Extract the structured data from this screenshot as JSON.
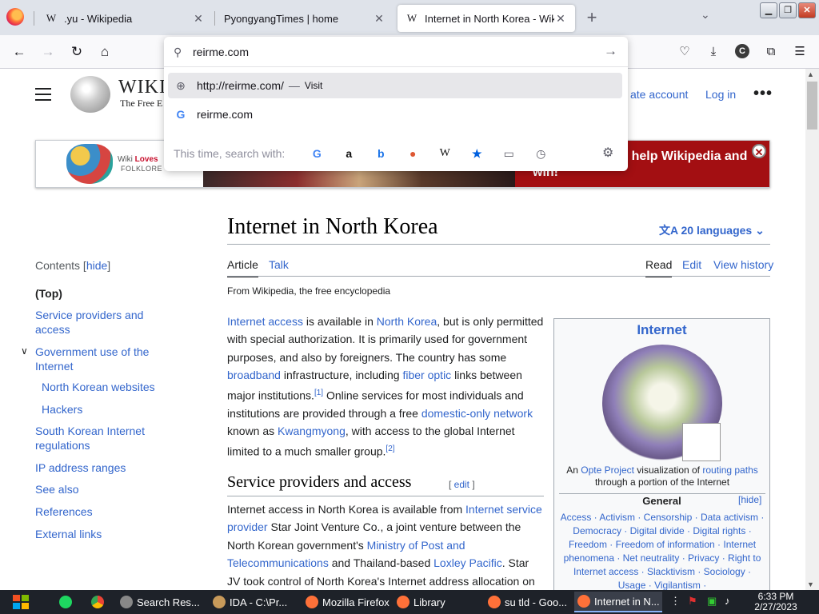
{
  "tabs": [
    {
      "title": ".yu - Wikipedia",
      "favicon": "W"
    },
    {
      "title": "PyongyangTimes | home",
      "favicon": ""
    },
    {
      "title": "Internet in North Korea - Wikipedia",
      "favicon": "W"
    }
  ],
  "url_bar": {
    "value": "reirme.com",
    "suggestions": [
      {
        "url": "http://reirme.com/",
        "action": "Visit"
      },
      {
        "text": "reirme.com"
      }
    ],
    "search_with_label": "This time, search with:",
    "engines": [
      "google-icon",
      "amazon-icon",
      "bing-icon",
      "duckduckgo-icon",
      "wikipedia-icon",
      "bookmarks-icon",
      "tabs-icon",
      "history-icon"
    ]
  },
  "wiki_header": {
    "wordmark": "WIKI",
    "tagline": "The Free E",
    "create_account": "ate account",
    "log_in": "Log in"
  },
  "banner": {
    "logo_line1a": "Wiki ",
    "logo_line1b": "Loves",
    "logo_line2": "FOLKLORE",
    "text": "ur local culture, help Wikipedia and win!"
  },
  "article": {
    "title": "Internet in North Korea",
    "languages": "20 languages",
    "tabs_left": [
      "Article",
      "Talk"
    ],
    "tabs_right": [
      "Read",
      "Edit",
      "View history"
    ],
    "tagline": "From Wikipedia, the free encyclopedia",
    "para1": {
      "a1": "Internet access",
      "t1": " is available in ",
      "a2": "North Korea",
      "t2": ", but is only permitted with special authorization. It is primarily used for government purposes, and also by foreigners. The country has some ",
      "a3": "broadband",
      "t3": " infrastructure, including ",
      "a4": "fiber optic",
      "t4": " links between major institutions.",
      "ref1": "[1]",
      "t5": " Online services for most individuals and institutions are provided through a free ",
      "a5": "domestic-only network",
      "t6": " known as ",
      "a6": "Kwangmyong",
      "t7": ", with access to the global Internet limited to a much smaller group.",
      "ref2": "[2]"
    },
    "section1": {
      "heading": "Service providers and access",
      "edit_open": "[ ",
      "edit": "edit",
      "edit_close": " ]",
      "t1": "Internet access in North Korea is available from ",
      "a1": "Internet service provider",
      "t2": " Star Joint Venture Co., a joint venture between the North Korean government's ",
      "a2": "Ministry of Post and Telecommunications",
      "t3": " and Thailand-based ",
      "a3": "Loxley Pacific",
      "t4": ". Star JV took control of North Korea's Internet address allocation on"
    }
  },
  "toc": {
    "heading": "Contents",
    "hide": "hide",
    "items": [
      "(Top)",
      "Service providers and access",
      "Government use of the Internet",
      "North Korean websites",
      "Hackers",
      "South Korean Internet regulations",
      "IP address ranges",
      "See also",
      "References",
      "External links"
    ]
  },
  "infobox": {
    "title": "Internet",
    "caption_t1": "An ",
    "caption_a1": "Opte Project",
    "caption_t2": " visualization of ",
    "caption_a2": "routing paths",
    "caption_t3": " through a portion of the Internet",
    "general": "General",
    "hide": "[hide]",
    "links": "Access · Activism · Censorship · Data activism · Democracy · Digital divide · Digital rights · Freedom · Freedom of information · Internet phenomena · Net neutrality · Privacy · Right to Internet access · Slacktivism · Sociology · Usage · Vigilantism ·"
  },
  "taskbar": {
    "apps": [
      "Search Res...",
      "IDA - C:\\Pr...",
      "Mozilla Firefox",
      "Library",
      "su tld - Goo...",
      "Internet in N..."
    ],
    "time": "6:33 PM",
    "date": "2/27/2023"
  }
}
